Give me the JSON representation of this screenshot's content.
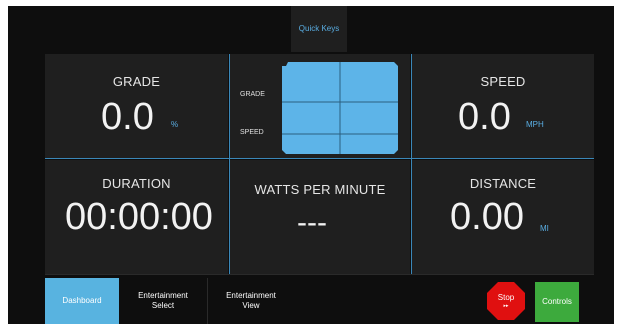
{
  "quick_keys": {
    "label": "Quick Keys"
  },
  "grade": {
    "title": "GRADE",
    "value": "0.0",
    "unit": "%"
  },
  "speed": {
    "title": "SPEED",
    "value": "0.0",
    "unit": "MPH"
  },
  "graph": {
    "grade_label": "GRADE",
    "speed_label": "SPEED"
  },
  "duration": {
    "title": "DURATION",
    "value": "00:00:00"
  },
  "watts": {
    "title": "WATTS PER MINUTE",
    "value": "---"
  },
  "distance": {
    "title": "DISTANCE",
    "value": "0.00",
    "unit": "MI"
  },
  "bottom_bar": {
    "dashboard": "Dashboard",
    "entertainment_select_line1": "Entertainment",
    "entertainment_select_line2": "Select",
    "entertainment_view_line1": "Entertainment",
    "entertainment_view_line2": "View",
    "stop_label": "Stop",
    "stop_sub": "▸▸",
    "controls": "Controls"
  },
  "colors": {
    "accent_blue": "#5aaee3",
    "graph_fill": "#5db4e8",
    "dashboard_tab": "#58b3e0",
    "stop_red": "#e01010",
    "controls_green": "#3daa3d"
  }
}
